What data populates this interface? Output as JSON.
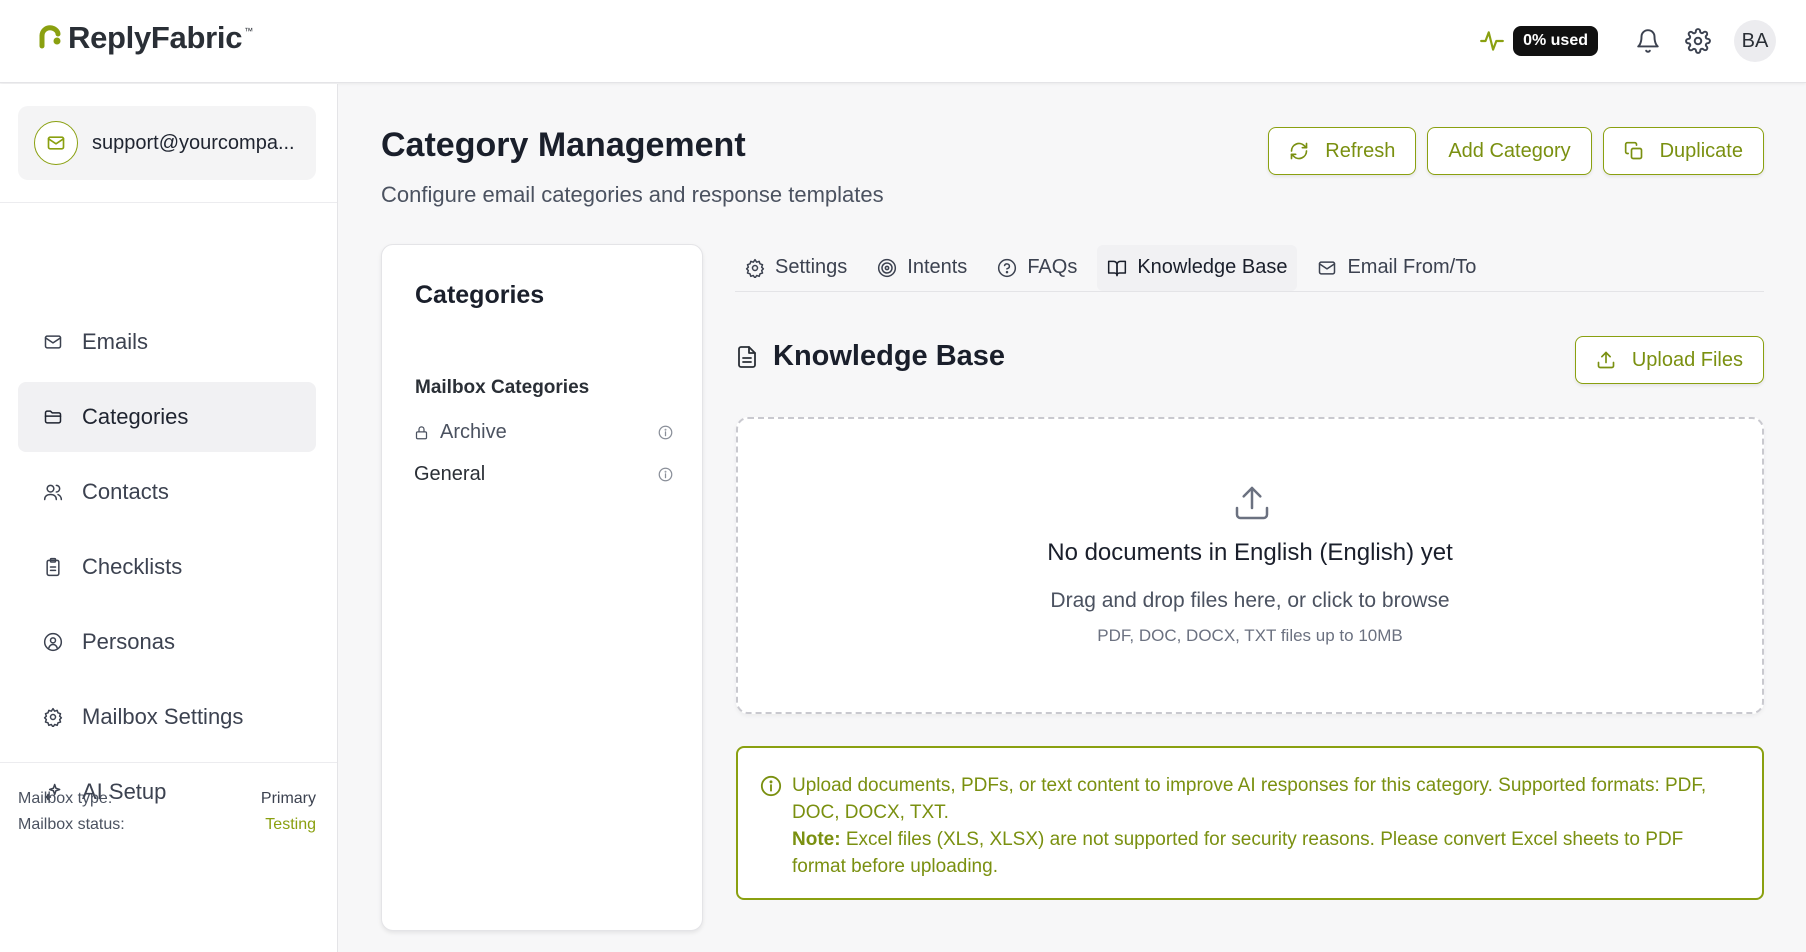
{
  "header": {
    "brand": "ReplyFabric",
    "trademark": "™",
    "usage": "0% used",
    "avatar_initials": "BA",
    "icons": [
      "pulse-icon",
      "bell-icon",
      "gear-icon"
    ]
  },
  "sidebar": {
    "mailbox": "support@yourcompa...",
    "nav": [
      {
        "label": "Emails",
        "icon": "mail-icon"
      },
      {
        "label": "Categories",
        "icon": "folder-icon",
        "active": true
      },
      {
        "label": "Contacts",
        "icon": "users-icon"
      },
      {
        "label": "Checklists",
        "icon": "clipboard-icon"
      },
      {
        "label": "Personas",
        "icon": "user-circle-icon"
      },
      {
        "label": "Mailbox Settings",
        "icon": "gear-icon"
      },
      {
        "label": "AI Setup",
        "icon": "sparkles-icon"
      }
    ],
    "meta": {
      "type_label": "Mailbox type:",
      "type_value": "Primary",
      "status_label": "Mailbox status:",
      "status_value": "Testing"
    }
  },
  "main": {
    "title": "Category Management",
    "subtitle": "Configure email categories and response templates",
    "buttons": {
      "refresh": "Refresh",
      "add": "Add Category",
      "duplicate": "Duplicate"
    }
  },
  "categories": {
    "title": "Categories",
    "group": "Mailbox Categories",
    "items": [
      "Archive",
      "General"
    ]
  },
  "tabs": [
    {
      "label": "Settings",
      "icon": "gear-icon"
    },
    {
      "label": "Intents",
      "icon": "target-icon"
    },
    {
      "label": "FAQs",
      "icon": "help-circle-icon"
    },
    {
      "label": "Knowledge Base",
      "icon": "book-icon",
      "active": true
    },
    {
      "label": "Email From/To",
      "icon": "mail-icon"
    }
  ],
  "knowledge": {
    "title": "Knowledge Base",
    "upload_label": "Upload Files",
    "empty_title": "No documents in English (English) yet",
    "empty_sub": "Drag and drop files here, or click to browse",
    "empty_hint": "PDF, DOC, DOCX, TXT files up to 10MB",
    "notice_text": "Upload documents, PDFs, or text content to improve AI responses for this category. Supported formats: PDF, DOC, DOCX, TXT.",
    "note_label": "Note:",
    "note_text": " Excel files (XLS, XLSX) are not supported for security reasons. Please convert Excel sheets to PDF format before uploading."
  },
  "colors": {
    "accent": "#8aa010",
    "accent_text": "#7a9010"
  }
}
